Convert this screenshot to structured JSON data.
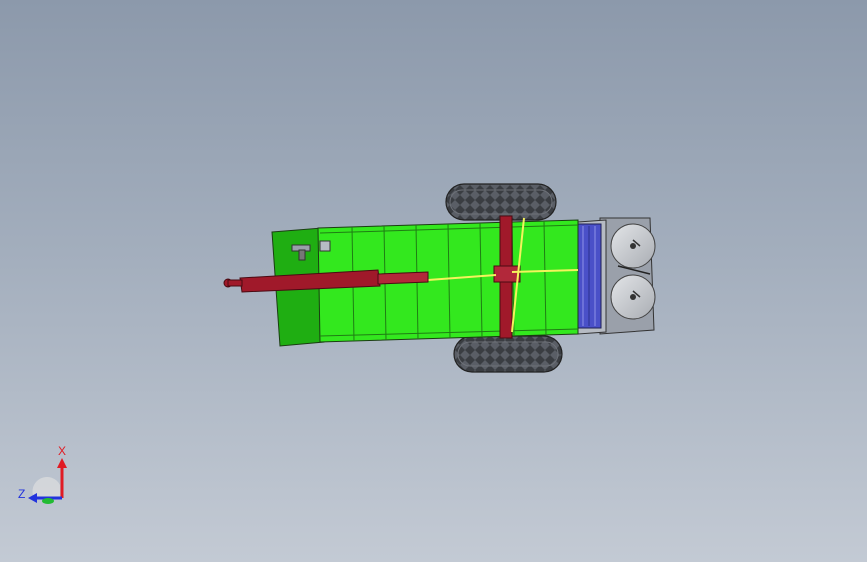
{
  "view": {
    "background_top": "#8c99ab",
    "background_bottom": "#c3cad4"
  },
  "model": {
    "hopper_color": "#33e81e",
    "hopper_dark_color": "#1fae12",
    "drawbar_color": "#a0192a",
    "beam_color": "#f4f35c",
    "tire_color": "#3a3d42",
    "disc_color": "#c9ccd0",
    "roller_color": "#4a50c8"
  },
  "triad": {
    "x_label": "X",
    "z_label": "Z",
    "x_color": "#e01b24",
    "z_color": "#2233dd",
    "y_color": "#22bb33"
  }
}
